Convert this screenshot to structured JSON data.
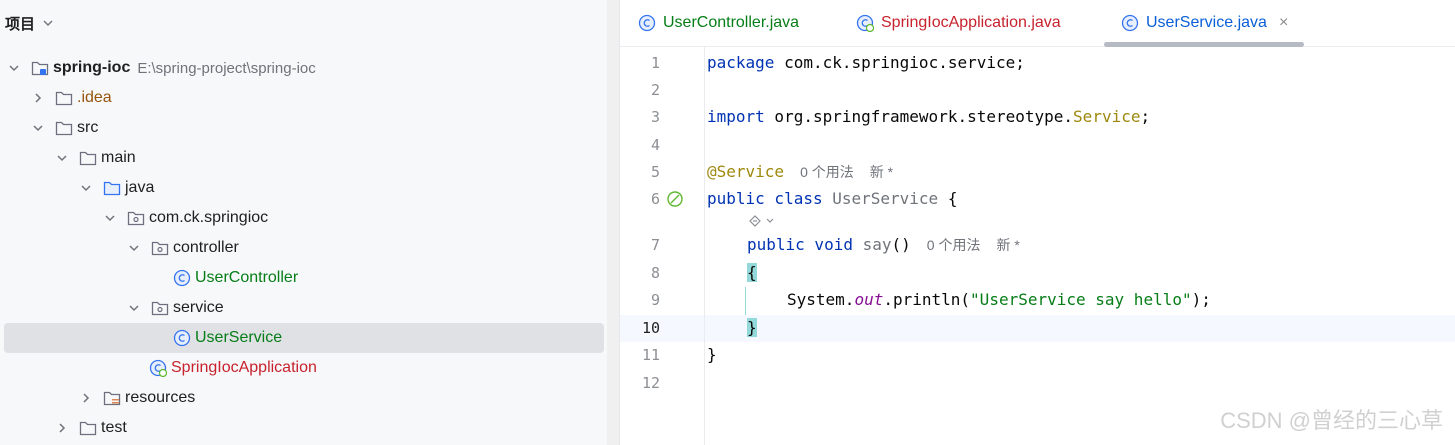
{
  "project": {
    "header_title": "项目",
    "tree": [
      {
        "label": "spring-ioc",
        "path": "E:\\spring-project\\spring-ioc",
        "icon": "module-folder-icon",
        "expanded": true
      },
      {
        "label": ".idea",
        "icon": "folder-icon",
        "expanded": false
      },
      {
        "label": "src",
        "icon": "folder-icon",
        "expanded": true
      },
      {
        "label": "main",
        "icon": "folder-icon",
        "expanded": true
      },
      {
        "label": "java",
        "icon": "source-folder-icon",
        "expanded": true
      },
      {
        "label": "com.ck.springioc",
        "icon": "package-icon",
        "expanded": true
      },
      {
        "label": "controller",
        "icon": "package-icon",
        "expanded": true
      },
      {
        "label": "UserController",
        "icon": "class-icon"
      },
      {
        "label": "service",
        "icon": "package-icon",
        "expanded": true
      },
      {
        "label": "UserService",
        "icon": "class-icon",
        "selected": true
      },
      {
        "label": "SpringIocApplication",
        "icon": "spring-boot-class-icon"
      },
      {
        "label": "resources",
        "icon": "resources-folder-icon",
        "expanded": false
      },
      {
        "label": "test",
        "icon": "folder-icon",
        "expanded": false
      }
    ]
  },
  "tabs": [
    {
      "label": "UserController.java",
      "icon": "class-icon"
    },
    {
      "label": "SpringIocApplication.java",
      "icon": "spring-boot-class-icon"
    },
    {
      "label": "UserService.java",
      "icon": "class-icon",
      "active": true,
      "close": "×"
    }
  ],
  "editor": {
    "line_numbers": [
      "1",
      "2",
      "3",
      "4",
      "5",
      "6",
      "7",
      "8",
      "9",
      "10",
      "11",
      "12"
    ],
    "current_line": "10",
    "code": {
      "l1_kw": "package",
      "l1_rest": " com.ck.springioc.service;",
      "l3_kw": "import",
      "l3_rest": " org.springframework.stereotype.",
      "l3_cls": "Service",
      "l3_end": ";",
      "l5_ann": "@Service",
      "l5_hint1": "0 个用法",
      "l5_hint2": "新 *",
      "l6_kw": "public class",
      "l6_name": " UserService",
      "l6_end": " {",
      "l7_kw": "public void",
      "l7_name": " say",
      "l7_end": "()",
      "l7_hint1": "0 个用法",
      "l7_hint2": "新 *",
      "l8_brace": "{",
      "l9_pre": "System.",
      "l9_fld": "out",
      "l9_mid": ".println(",
      "l9_str": "\"UserService say hello\"",
      "l9_end": ");",
      "l10_brace": "}",
      "l11_brace": "}"
    }
  },
  "watermark": "CSDN @曾经的三心草",
  "colors": {
    "keyword": "#0033b3",
    "annotation": "#9e880d",
    "string": "#067d17",
    "class_file": "#067d17",
    "spring_class": "#c7222d",
    "active_tab": "#0a5fd8",
    "selection": "#dfe1e5"
  }
}
